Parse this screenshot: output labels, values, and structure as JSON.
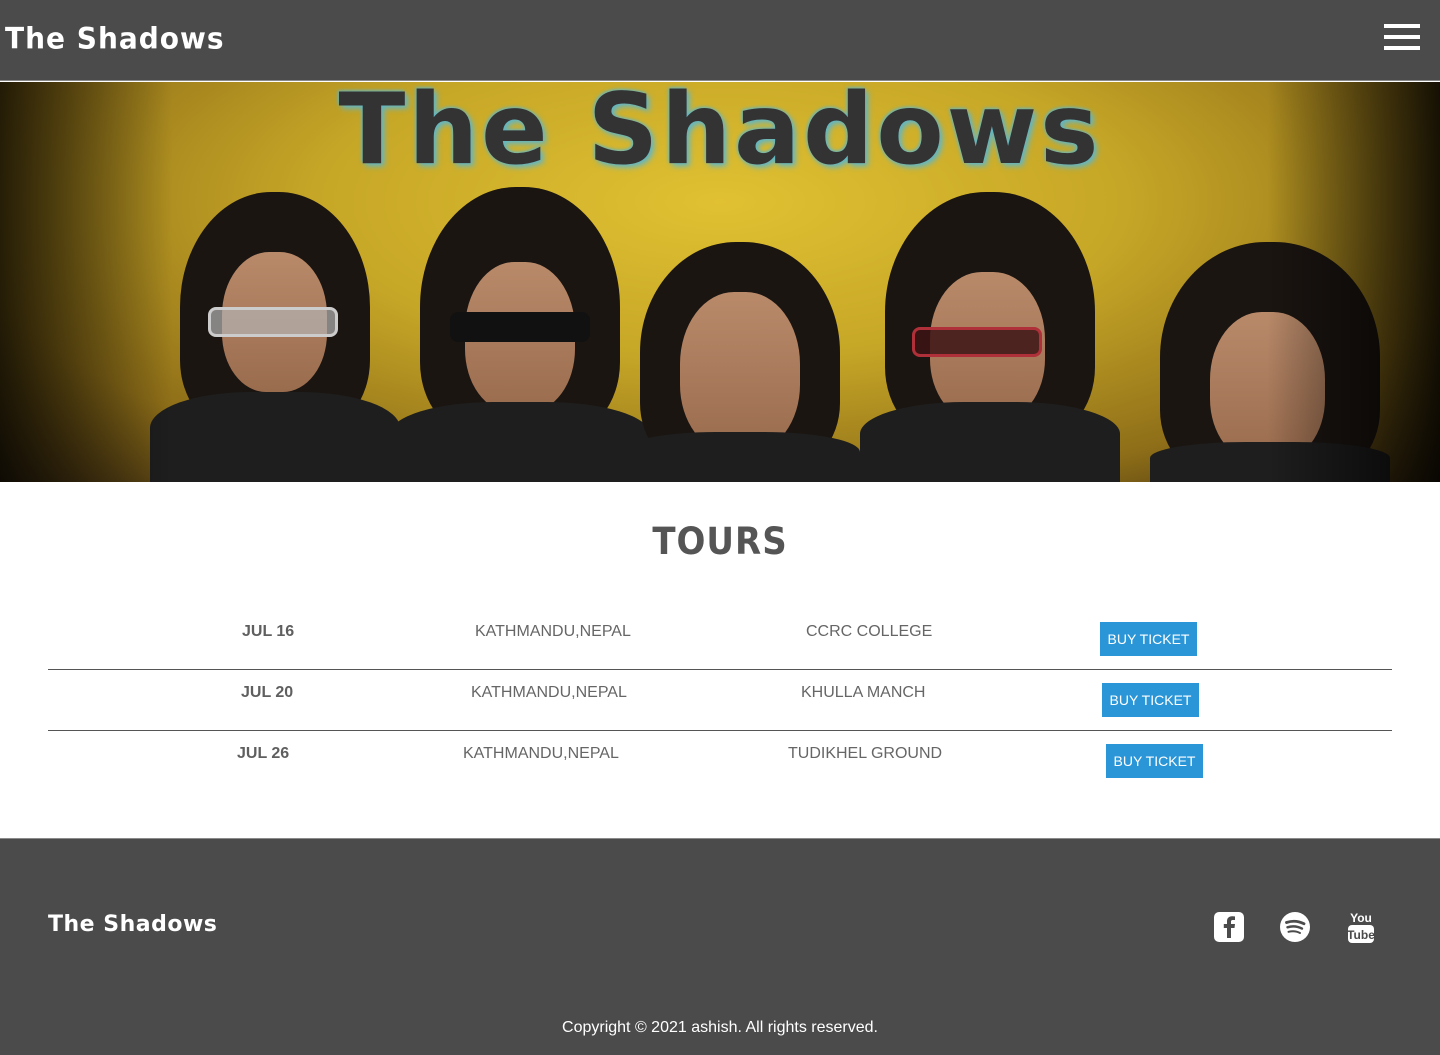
{
  "nav": {
    "brand": "The Shadows",
    "menu_icon": "hamburger-menu-icon"
  },
  "hero": {
    "title": "The Shadows",
    "background_color": "#c6a626",
    "title_color": "#333333",
    "title_glow": "#5fb6c8"
  },
  "tours": {
    "heading": "TOURS",
    "rows": [
      {
        "date": "JUL 16",
        "location": "KATHMANDU,NEPAL",
        "venue": "CCRC COLLEGE",
        "button": "BUY TICKET"
      },
      {
        "date": "JUL 20",
        "location": "KATHMANDU,NEPAL",
        "venue": "KHULLA MANCH",
        "button": "BUY TICKET"
      },
      {
        "date": "JUL 26",
        "location": "KATHMANDU,NEPAL",
        "venue": "TUDIKHEL GROUND",
        "button": "BUY TICKET"
      }
    ]
  },
  "footer": {
    "brand": "The Shadows",
    "social": [
      {
        "name": "facebook-icon"
      },
      {
        "name": "spotify-icon"
      },
      {
        "name": "youtube-icon",
        "label_top": "You",
        "label_bottom": "Tube"
      }
    ],
    "copyright": "Copyright © 2021 ashish. All rights reserved."
  },
  "colors": {
    "header_bg": "#4b4b4b",
    "button_bg": "#2a96d8",
    "text_muted": "#666666"
  }
}
